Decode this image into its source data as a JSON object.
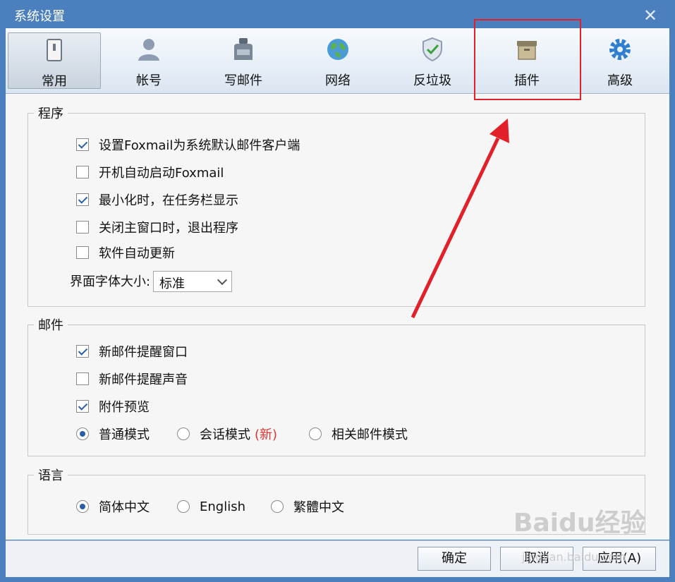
{
  "window": {
    "title": "系统设置"
  },
  "tabs": [
    {
      "label": "常用",
      "icon": "switch-icon"
    },
    {
      "label": "帐号",
      "icon": "user-icon"
    },
    {
      "label": "写邮件",
      "icon": "ink-bottle-icon"
    },
    {
      "label": "网络",
      "icon": "globe-icon"
    },
    {
      "label": "反垃圾",
      "icon": "shield-icon"
    },
    {
      "label": "插件",
      "icon": "plugin-box-icon"
    },
    {
      "label": "高级",
      "icon": "gear-icon"
    }
  ],
  "program_group": {
    "title": "程序",
    "items": [
      {
        "label": "设置Foxmail为系统默认邮件客户端",
        "checked": true
      },
      {
        "label": "开机自动启动Foxmail",
        "checked": false
      },
      {
        "label": "最小化时，在任务栏显示",
        "checked": true
      },
      {
        "label": "关闭主窗口时，退出程序",
        "checked": false
      },
      {
        "label": "软件自动更新",
        "checked": false
      }
    ],
    "font_size_label": "界面字体大小:",
    "font_size_value": "标准"
  },
  "mail_group": {
    "title": "邮件",
    "items": [
      {
        "label": "新邮件提醒窗口",
        "checked": true
      },
      {
        "label": "新邮件提醒声音",
        "checked": false
      },
      {
        "label": "附件预览",
        "checked": true
      }
    ],
    "modes": [
      {
        "label": "普通模式",
        "selected": true
      },
      {
        "label": "会话模式",
        "badge": "(新)",
        "selected": false
      },
      {
        "label": "相关邮件模式",
        "selected": false
      }
    ]
  },
  "language_group": {
    "title": "语言",
    "options": [
      {
        "label": "简体中文",
        "selected": true
      },
      {
        "label": "English",
        "selected": false
      },
      {
        "label": "繁體中文",
        "selected": false
      }
    ]
  },
  "footer": {
    "ok": "确定",
    "cancel": "取消",
    "apply": "应用(A)"
  },
  "watermark": {
    "brand": "Baidu经验",
    "url": "jingyan.baidu.com"
  },
  "colors": {
    "title_bar": "#4c7fbe",
    "highlight": "#e1202a",
    "check": "#2a5fa8",
    "badge": "#dd3333"
  }
}
